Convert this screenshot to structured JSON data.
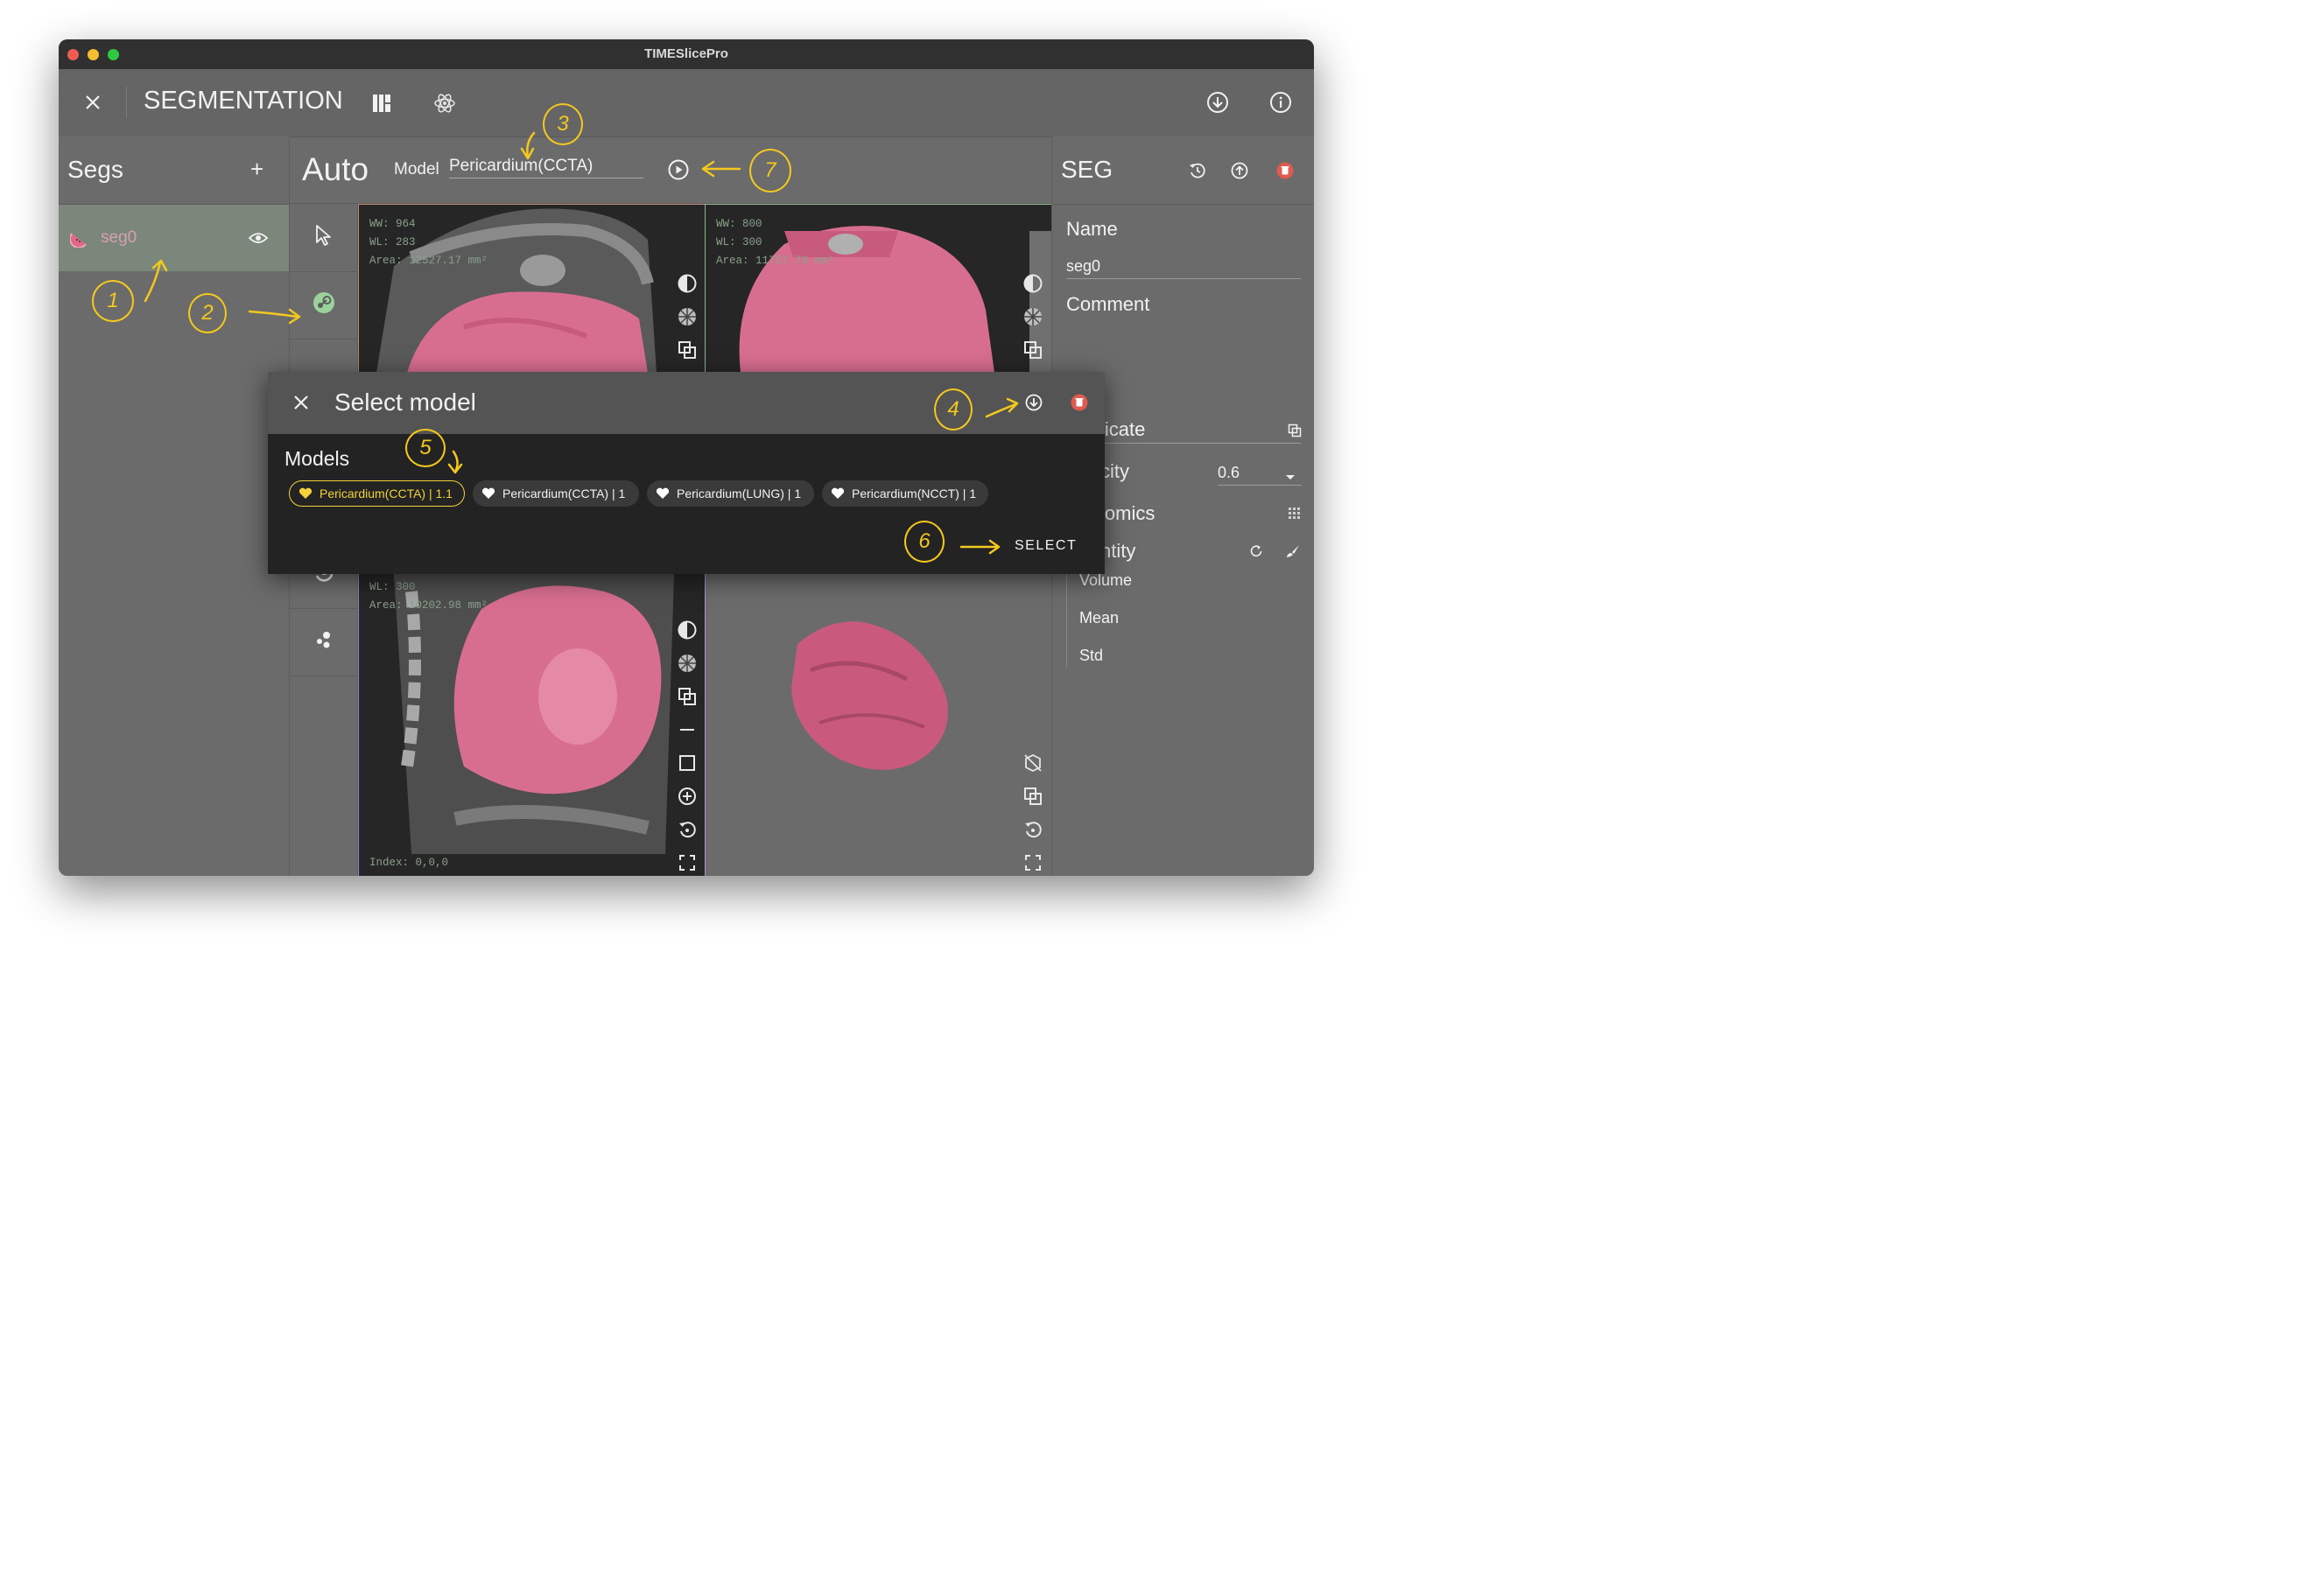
{
  "window": {
    "title": "TIMESlicePro"
  },
  "appbar": {
    "title": "SEGMENTATION"
  },
  "segs": {
    "title": "Segs",
    "add": "+",
    "items": [
      {
        "label": "seg0"
      }
    ]
  },
  "auto": {
    "title": "Auto",
    "model_label": "Model",
    "model_value": "Pericardium(CCTA)"
  },
  "viewports": {
    "top_left": {
      "ww": "WW: 964",
      "wl": "WL: 283",
      "area": "Area: 12527.17 mm²"
    },
    "top_right": {
      "ww": "WW: 800",
      "wl": "WL: 300",
      "area": "Area: 11757.78 mm²"
    },
    "bottom_left": {
      "wl": "WL: 300",
      "area": "Area: 10202.98 mm²",
      "index": "Index: 0,0,0"
    }
  },
  "seg_panel": {
    "title": "SEG",
    "name_label": "Name",
    "name_value": "seg0",
    "comment_label": "Comment",
    "duplicate_label": "licate",
    "opacity_label": "city",
    "opacity_value": "0.6",
    "radiomics_label": "iomics",
    "quantity_label": "ntity",
    "volume_label": "Volume",
    "mean_label": "Mean",
    "std_label": "Std"
  },
  "dialog": {
    "title": "Select model",
    "models_label": "Models",
    "models": [
      {
        "label": "Pericardium(CCTA) | 1.1",
        "selected": true
      },
      {
        "label": "Pericardium(CCTA) | 1",
        "selected": false
      },
      {
        "label": "Pericardium(LUNG) | 1",
        "selected": false
      },
      {
        "label": "Pericardium(NCCT) | 1",
        "selected": false
      }
    ],
    "select_button": "SELECT"
  },
  "annotations": [
    "1",
    "2",
    "3",
    "4",
    "5",
    "6",
    "7"
  ],
  "colors": {
    "accent": "#f4c81d",
    "selected_chip": "#f3d23a",
    "delete": "#e05a4f",
    "seg_mask": "#d86e8f",
    "window_bg": "#6b6b6b"
  },
  "icons": [
    "close-icon",
    "layout-icon",
    "atom-icon",
    "download-icon",
    "info-icon",
    "watermelon-icon",
    "eye-icon",
    "cursor-icon",
    "steam-icon",
    "play-icon",
    "history-icon",
    "upload-icon",
    "trash-icon",
    "copy-icon",
    "grid-icon",
    "refresh-icon",
    "brush-icon",
    "contrast-icon",
    "checker-icon",
    "layers-icon",
    "square-icon",
    "zoom-in-icon",
    "reset-icon",
    "fullscreen-icon",
    "cube-hidden-icon"
  ]
}
